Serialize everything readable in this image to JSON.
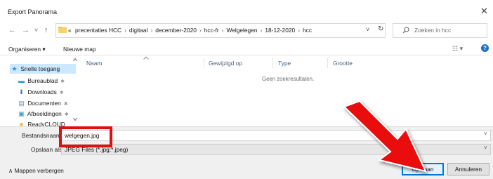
{
  "window": {
    "title": "Export Panorama",
    "close_glyph": "✕"
  },
  "nav": {
    "back_glyph": "←",
    "forward_glyph": "→",
    "recent_glyph": "˅",
    "up_glyph": "↑"
  },
  "address_bar": {
    "overflow": "«",
    "crumbs": [
      "precentaties HCC",
      "digitaal",
      "december-2020",
      "hcc-fr",
      "Welgelegen",
      "18-12-2020",
      "hcc"
    ],
    "separator": "›",
    "dropdown_glyph": "˅",
    "refresh_glyph": "↻"
  },
  "search": {
    "placeholder": "Zoeken in hcc",
    "icon": "search-icon"
  },
  "toolbar": {
    "organize_label": "Organiseren ▾",
    "new_folder_label": "Nieuwe map",
    "view_glyph": "☷ ▾",
    "help_glyph": "?"
  },
  "sidebar": {
    "items": [
      {
        "label": "Snelle toegang",
        "icon": "star-icon",
        "glyph": "★",
        "color": "#3b8ad8",
        "pinned": false
      },
      {
        "label": "Bureaublad",
        "icon": "desktop-icon",
        "glyph": "▬",
        "color": "#2a9fd6",
        "pinned": true
      },
      {
        "label": "Downloads",
        "icon": "download-icon",
        "glyph": "⬇",
        "color": "#2a78d0",
        "pinned": true
      },
      {
        "label": "Documenten",
        "icon": "documents-icon",
        "glyph": "▤",
        "color": "#6a8fb8",
        "pinned": true
      },
      {
        "label": "Afbeeldingen",
        "icon": "pictures-icon",
        "glyph": "▣",
        "color": "#3aa0c8",
        "pinned": true
      },
      {
        "label": "ReadyCLOUD",
        "icon": "folder-icon",
        "glyph": "■",
        "color": "#e8c25a",
        "pinned": false
      }
    ],
    "pin_glyph": "✱"
  },
  "columns": [
    "Naam",
    "Gewijzigd op",
    "Type",
    "Grootte"
  ],
  "empty_message": "Geen zoekresultaten.",
  "form": {
    "filename_label": "Bestandsnaam:",
    "filename_value": "welgegen.jpg",
    "filetype_label": "Opslaan als:",
    "filetype_value": "JPEG Files (*.jpg;*.jpeg)"
  },
  "footer": {
    "hide_folders_label": "∧  Mappen verbergen",
    "save_label": "Opslaan",
    "cancel_label": "Annuleren"
  },
  "annotation": {
    "color": "#e01010"
  }
}
